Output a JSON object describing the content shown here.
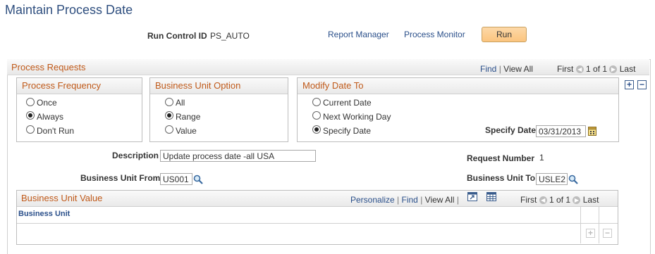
{
  "page_title": "Maintain Process Date",
  "run_control": {
    "label": "Run Control ID",
    "value": "PS_AUTO"
  },
  "header_links": {
    "report_manager": "Report Manager",
    "process_monitor": "Process Monitor",
    "run": "Run"
  },
  "process_requests": {
    "title": "Process Requests",
    "nav": {
      "find": "Find",
      "sep": "|",
      "view_all": "View All",
      "first": "First",
      "count": "1 of 1",
      "last": "Last"
    },
    "process_frequency": {
      "title": "Process Frequency",
      "options": [
        "Once",
        "Always",
        "Don't Run"
      ],
      "selected": "Always"
    },
    "business_unit_option": {
      "title": "Business Unit Option",
      "options": [
        "All",
        "Range",
        "Value"
      ],
      "selected": "Range"
    },
    "modify_date_to": {
      "title": "Modify Date To",
      "options": [
        "Current Date",
        "Next Working Day",
        "Specify Date"
      ],
      "selected": "Specify Date",
      "specify_date_label": "Specify Date",
      "specify_date_value": "03/31/2013"
    },
    "description": {
      "label": "Description",
      "value": "Update process date -all USA"
    },
    "request_number": {
      "label": "Request Number",
      "value": "1"
    },
    "bu_from": {
      "label": "Business Unit From",
      "value": "US001"
    },
    "bu_to": {
      "label": "Business Unit To",
      "value": "USLE2"
    },
    "add_row": "+",
    "delete_row": "−"
  },
  "business_unit_value": {
    "title": "Business Unit Value",
    "nav": {
      "personalize": "Personalize",
      "sep": "|",
      "find": "Find",
      "view_all": "View All",
      "first": "First",
      "count": "1 of 1",
      "last": "Last"
    },
    "column": "Business Unit",
    "add_row": "+",
    "delete_row": "−"
  }
}
